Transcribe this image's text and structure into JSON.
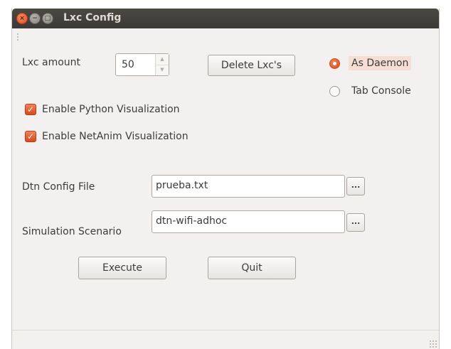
{
  "window": {
    "title": "Lxc Config",
    "close_glyph": "×",
    "minimize_glyph": "−",
    "maximize_glyph": "□"
  },
  "lxc": {
    "label": "Lxc amount",
    "value": "50",
    "delete_label": "Delete Lxc's"
  },
  "mode": {
    "options": [
      {
        "label": "As Daemon",
        "selected": true
      },
      {
        "label": "Tab Console",
        "selected": false
      }
    ]
  },
  "visualization": {
    "python_label": "Enable Python Visualization",
    "python_checked": true,
    "netanim_label": "Enable NetAnim Visualization",
    "netanim_checked": true,
    "check_glyph": "✓"
  },
  "config": {
    "dtn_label": "Dtn Config File",
    "dtn_value": "prueba.txt",
    "scenario_label": "Simulation Scenario",
    "scenario_value": "dtn-wifi-adhoc",
    "browse_label": "..."
  },
  "actions": {
    "execute_label": "Execute",
    "quit_label": "Quit"
  },
  "colors": {
    "accent": "#dd4814",
    "titlebar": "#3b3a36",
    "window_bg": "#f2f1f0"
  }
}
